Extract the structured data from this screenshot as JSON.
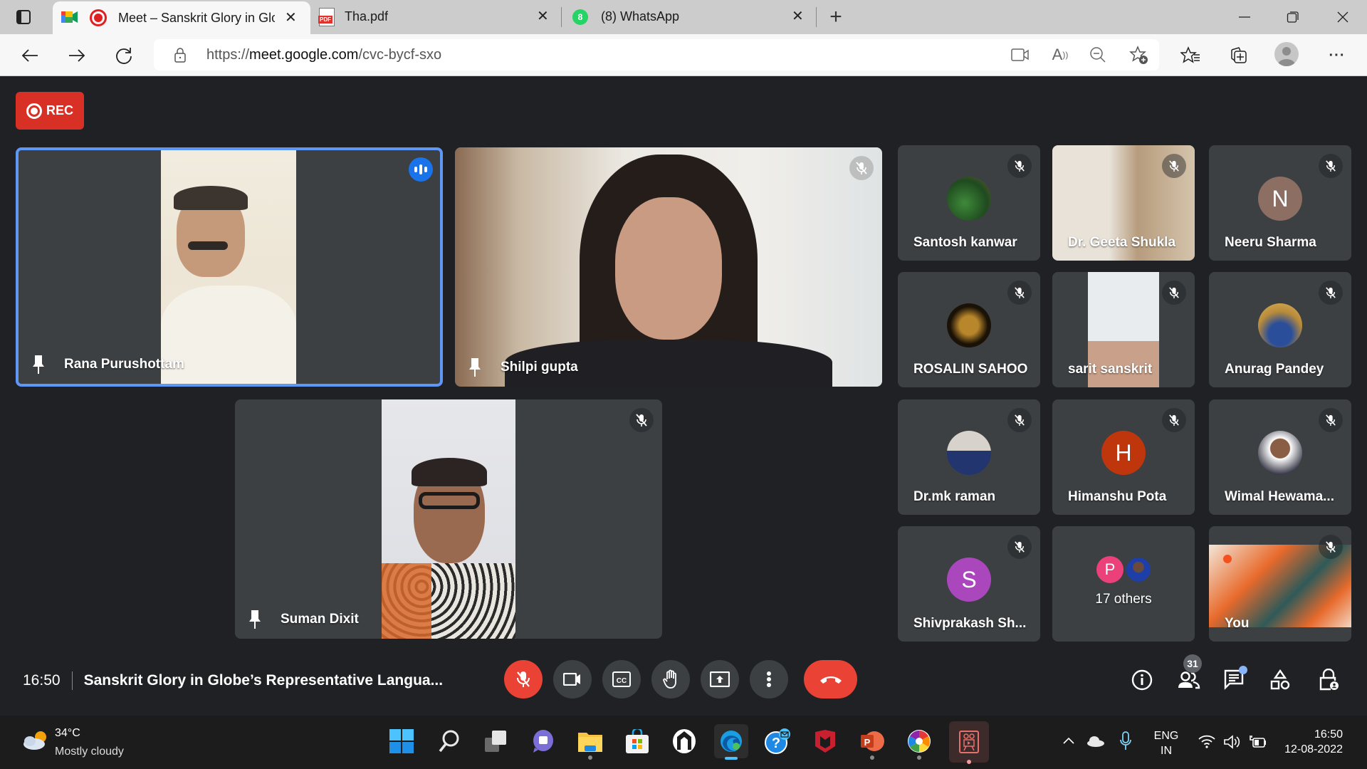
{
  "browser": {
    "tabs": [
      {
        "title": "Meet – Sanskrit Glory in Glo",
        "active": true,
        "icon": "google-meet-icon",
        "recording": true
      },
      {
        "title": "Tha.pdf",
        "active": false,
        "icon": "pdf-icon"
      },
      {
        "title": "(8) WhatsApp",
        "active": false,
        "icon": "whatsapp-icon",
        "badge": "8"
      }
    ],
    "url_prefix": "https://",
    "url_host": "meet.google.com",
    "url_path": "/cvc-bycf-sxo"
  },
  "meet": {
    "rec_label": "REC",
    "main_tiles": [
      {
        "name": "Rana Purushottam",
        "speaking": true
      },
      {
        "name": "Shilpi gupta",
        "muted": true
      },
      {
        "name": "Suman Dixit",
        "muted": true
      }
    ],
    "grid_tiles": [
      {
        "name": "Santosh kanwar",
        "avatar": "image",
        "muted": true
      },
      {
        "name": "Dr. Geeta Shukla",
        "avatar": "video",
        "muted": true
      },
      {
        "name": "Neeru Sharma",
        "avatar": "N",
        "avatar_color": "#8d6e63",
        "muted": true
      },
      {
        "name": "ROSALIN SAHOO",
        "avatar": "image",
        "muted": true
      },
      {
        "name": "sarit sanskrit",
        "avatar": "video",
        "muted": true
      },
      {
        "name": "Anurag Pandey",
        "avatar": "image",
        "muted": true
      },
      {
        "name": "Dr.mk raman",
        "avatar": "image",
        "muted": true
      },
      {
        "name": "Himanshu Pota",
        "avatar": "H",
        "avatar_color": "#bf360c",
        "muted": true
      },
      {
        "name": "Wimal Hewama...",
        "avatar": "image",
        "muted": true
      },
      {
        "name": "Shivprakash Sh...",
        "avatar": "S",
        "avatar_color": "#ab47bc",
        "muted": true
      },
      {
        "name": "17 others",
        "avatar": "P",
        "avatar_color": "#ec407a"
      },
      {
        "name": "You",
        "avatar": "video",
        "muted": true
      }
    ],
    "time": "16:50",
    "meeting_title": "Sanskrit Glory in Globe’s Representative Langua...",
    "participants_count": "31",
    "colors": {
      "accent": "#1a73e8",
      "danger": "#ea4335",
      "rec": "#d93025",
      "tile": "#3c4043",
      "bg": "#202124"
    }
  },
  "taskbar": {
    "weather_temp": "34°C",
    "weather_desc": "Mostly cloudy",
    "lang_top": "ENG",
    "lang_bottom": "IN",
    "clock_time": "16:50",
    "clock_date": "12-08-2022"
  }
}
